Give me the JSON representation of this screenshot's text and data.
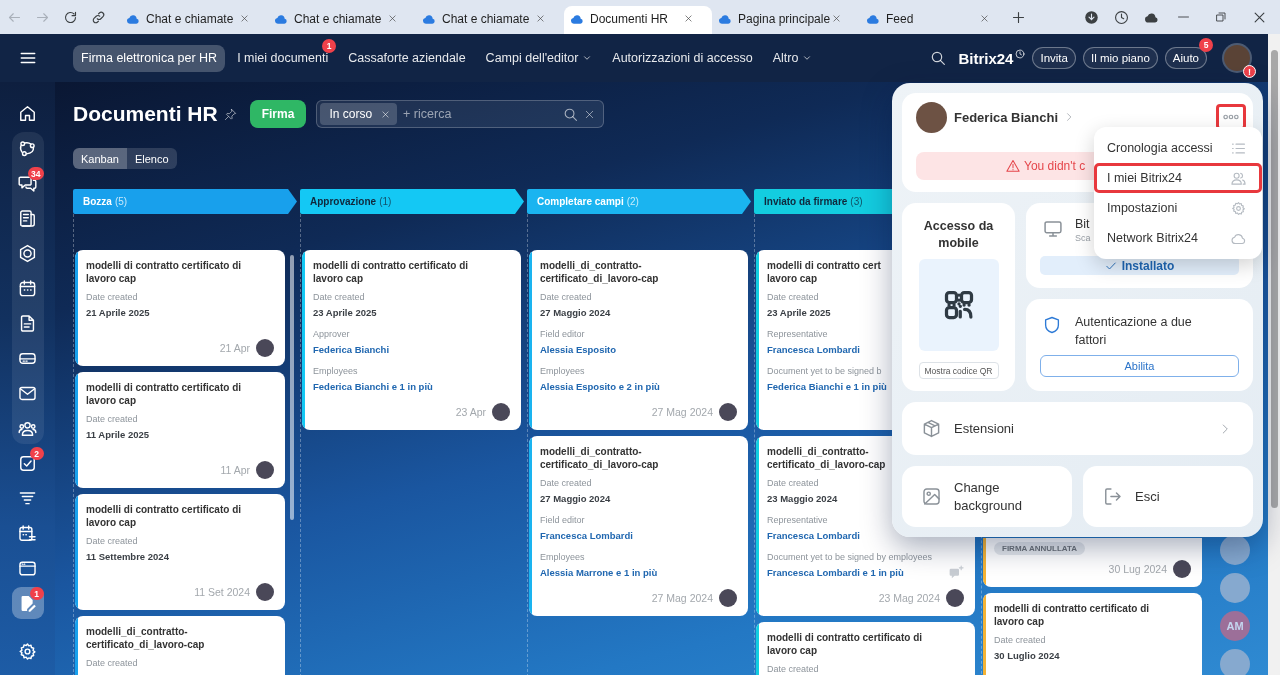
{
  "browser": {
    "nav_buttons": [
      {
        "kind": "back",
        "disabled": true
      },
      {
        "kind": "forward",
        "disabled": true
      },
      {
        "kind": "reload",
        "disabled": false
      },
      {
        "kind": "link",
        "disabled": false
      }
    ],
    "tabs": [
      {
        "title": "Chat e chiamate",
        "selected": false
      },
      {
        "title": "Chat e chiamate",
        "selected": false
      },
      {
        "title": "Chat e chiamate",
        "selected": false
      },
      {
        "title": "Documenti HR",
        "selected": true
      },
      {
        "title": "Pagina principale",
        "selected": false
      },
      {
        "title": "Feed",
        "selected": false
      }
    ]
  },
  "header": {
    "nav": [
      {
        "label": "Firma elettronica per HR",
        "selected": true
      },
      {
        "label": "I miei documenti",
        "selected": false,
        "badge": "1"
      },
      {
        "label": "Cassaforte aziendale",
        "selected": false
      },
      {
        "label": "Campi dell'editor",
        "selected": false,
        "dropdown": true
      },
      {
        "label": "Autorizzazioni di accesso",
        "selected": false
      },
      {
        "label": "Altro",
        "selected": false,
        "dropdown": true
      }
    ],
    "logo": "Bitrix24",
    "buttons": [
      {
        "label": "Invita"
      },
      {
        "label": "Il mio piano"
      },
      {
        "label": "Aiuto",
        "badge": "5"
      }
    ],
    "avatar_badge": "!"
  },
  "sidebar": {
    "sections": [
      {
        "framed": false,
        "items": [
          {
            "kind": "home",
            "selected": false
          }
        ]
      },
      {
        "framed": true,
        "items": [
          {
            "kind": "nodes",
            "selected": false
          },
          {
            "kind": "chat",
            "selected": false,
            "badge": "34"
          },
          {
            "kind": "feed",
            "selected": false
          },
          {
            "kind": "hexagon",
            "selected": false
          },
          {
            "kind": "calendar",
            "selected": false
          },
          {
            "kind": "document",
            "selected": false
          },
          {
            "kind": "drive",
            "selected": false
          },
          {
            "kind": "mail",
            "selected": false
          },
          {
            "kind": "team",
            "selected": false
          }
        ]
      },
      {
        "framed": false,
        "items": [
          {
            "kind": "tasks",
            "selected": false,
            "badge": "2"
          },
          {
            "kind": "funnel",
            "selected": false
          },
          {
            "kind": "planner",
            "selected": false
          },
          {
            "kind": "window",
            "selected": false
          },
          {
            "kind": "signature",
            "selected": true,
            "badge": "1"
          }
        ]
      },
      {
        "framed": false,
        "items": [
          {
            "kind": "settings",
            "selected": false
          }
        ]
      }
    ]
  },
  "toolbar": {
    "title": "Documenti HR",
    "action": "Firma",
    "filter_chips": [
      {
        "label": "In corso"
      }
    ],
    "search_placeholder": "+ ricerca",
    "views": [
      {
        "label": "Kanban",
        "selected": true
      },
      {
        "label": "Elenco",
        "selected": false
      }
    ]
  },
  "board": {
    "columns": [
      {
        "name": "Bozza",
        "count": "(5)",
        "color": "#18a0ec",
        "scrollbar": true,
        "cards": [
          {
            "title_lines": [
              "modelli di contratto certificato di",
              "lavoro cap"
            ],
            "fields": [
              {
                "label": "Date created",
                "value": "21 Aprile 2025",
                "kind": "text"
              }
            ],
            "date": "21 Apr"
          },
          {
            "title_lines": [
              "modelli di contratto certificato di",
              "lavoro cap"
            ],
            "fields": [
              {
                "label": "Date created",
                "value": "11 Aprile 2025",
                "kind": "text"
              }
            ],
            "date": "11 Apr"
          },
          {
            "title_lines": [
              "modelli di contratto certificato di",
              "lavoro cap"
            ],
            "fields": [
              {
                "label": "Date created",
                "value": "11 Settembre 2024",
                "kind": "text"
              }
            ],
            "date": "11 Set 2024"
          },
          {
            "title_lines": [
              "modelli_di_contratto-",
              "certificato_di_lavoro-cap"
            ],
            "fields": [
              {
                "label": "Date created"
              }
            ]
          }
        ]
      },
      {
        "name": "Approvazione",
        "count": "(1)",
        "color": "#14c8f4",
        "cards": [
          {
            "title_lines": [
              "modelli di contratto certificato di",
              "lavoro cap"
            ],
            "fields": [
              {
                "label": "Date created",
                "value": "23 Aprile 2025",
                "kind": "text"
              },
              {
                "label": "Approver",
                "value": "Federica Bianchi",
                "kind": "person"
              },
              {
                "label": "Employees",
                "value": "Federica Bianchi e 1 in più",
                "kind": "person"
              }
            ],
            "date": "23 Apr"
          }
        ]
      },
      {
        "name": "Completare campi",
        "count": "(2)",
        "color": "#1ab4f0",
        "cards": [
          {
            "title_lines": [
              "modelli_di_contratto-",
              "certificato_di_lavoro-cap"
            ],
            "fields": [
              {
                "label": "Date created",
                "value": "27 Maggio 2024",
                "kind": "text"
              },
              {
                "label": "Field editor",
                "value": "Alessia Esposito",
                "kind": "person"
              },
              {
                "label": "Employees",
                "value": "Alessia Esposito e 2 in più",
                "kind": "person"
              }
            ],
            "date": "27 Mag 2024"
          },
          {
            "title_lines": [
              "modelli_di_contratto-",
              "certificato_di_lavoro-cap"
            ],
            "fields": [
              {
                "label": "Date created",
                "value": "27 Maggio 2024",
                "kind": "text"
              },
              {
                "label": "Field editor",
                "value": "Francesca Lombardi",
                "kind": "person"
              },
              {
                "label": "Employees",
                "value": "Alessia Marrone e 1 in più",
                "kind": "person"
              }
            ],
            "date": "27 Mag 2024"
          }
        ]
      },
      {
        "name": "Inviato da firmare",
        "count": "(3)",
        "color": "#13cde0",
        "cards": [
          {
            "title_lines": [
              "modelli di contratto cert",
              "lavoro cap"
            ],
            "fields": [
              {
                "label": "Date created",
                "value": "23 Aprile 2025",
                "kind": "text"
              },
              {
                "label": "Representative",
                "value": "Francesca Lombardi",
                "kind": "person"
              },
              {
                "label": "Document yet to be signed b",
                "value": "Federica Bianchi e 1 in più",
                "kind": "person"
              }
            ]
          },
          {
            "title_lines": [
              "modelli_di_contratto-",
              "certificato_di_lavoro-cap"
            ],
            "fields": [
              {
                "label": "Date created",
                "value": "23 Maggio 2024",
                "kind": "text"
              },
              {
                "label": "Representative",
                "value": "Francesca Lombardi",
                "kind": "person"
              },
              {
                "label": "Document yet to be signed by employees",
                "value": "Francesca Lombardi e 1 in più",
                "kind": "person"
              }
            ],
            "comment": true,
            "date": "23 Mag 2024"
          },
          {
            "title_lines": [
              "modelli di contratto certificato di",
              "lavoro cap"
            ],
            "fields": [
              {
                "label": "Date created"
              }
            ]
          }
        ]
      },
      {
        "color": "#f5b335",
        "cards": [
          {
            "covered": true,
            "tag": "FIRMA ANNULLATA",
            "date": "30 Lug 2024"
          },
          {
            "title_lines": [
              "modelli di contratto certificato di",
              "lavoro cap"
            ],
            "fields": [
              {
                "label": "Date created",
                "value": "30 Luglio 2024",
                "kind": "text"
              }
            ]
          }
        ]
      }
    ]
  },
  "people": [
    {
      "kind": "photo"
    },
    {
      "kind": "photo"
    },
    {
      "kind": "initials",
      "initials": "AM"
    },
    {
      "kind": "photo"
    }
  ],
  "profile_panel": {
    "user": {
      "name": "Federica Bianchi"
    },
    "more_button": {
      "highlighted": true
    },
    "warning": "You didn't c",
    "mobile": {
      "title": "Accesso da mobile",
      "button": "Mostra codice QR"
    },
    "desktop": {
      "title": "Bit",
      "subtitle": "Sca",
      "status": "Installato"
    },
    "two_factor": {
      "title": "Autenticazione a due fattori",
      "button": "Abilita"
    },
    "extensions": {
      "label": "Estensioni"
    },
    "actions": [
      {
        "kind": "background",
        "label": "Change background"
      },
      {
        "kind": "logout",
        "label": "Esci"
      }
    ]
  },
  "menu": {
    "items": [
      {
        "kind": "history",
        "label": "Cronologia accessi",
        "highlighted": false
      },
      {
        "kind": "accounts",
        "label": "I miei Bitrix24",
        "highlighted": true
      },
      {
        "kind": "settings",
        "label": "Impostazioni",
        "highlighted": false
      },
      {
        "kind": "network",
        "label": "Network Bitrix24",
        "highlighted": false
      }
    ]
  }
}
